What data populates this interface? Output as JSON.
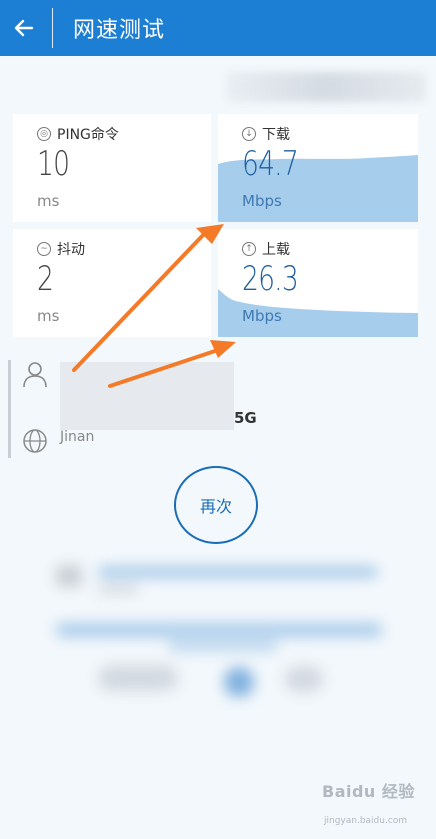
{
  "header": {
    "title": "网速测试",
    "back_icon": "arrow-left-icon"
  },
  "metrics": {
    "ping": {
      "label": "PING命令",
      "value": "10",
      "unit": "ms",
      "icon": "ping-icon"
    },
    "download": {
      "label": "下载",
      "value": "64.7",
      "unit": "Mbps",
      "icon": "download-arrow-icon"
    },
    "jitter": {
      "label": "抖动",
      "value": "2",
      "unit": "ms",
      "icon": "jitter-wave-icon"
    },
    "upload": {
      "label": "上载",
      "value": "26.3",
      "unit": "Mbps",
      "icon": "upload-arrow-icon"
    }
  },
  "connection": {
    "network_suffix": "5G",
    "location": "Jinan",
    "icons": [
      "person-icon",
      "globe-icon"
    ]
  },
  "actions": {
    "again_label": "再次"
  },
  "watermark": {
    "text": "Baidu 经验",
    "sub": "jingyan.baidu.com"
  },
  "colors": {
    "appbar": "#1c7fd4",
    "graph_fill": "#a6cdec",
    "accent_arrow": "#f47a28",
    "button_ring": "#1b6db6"
  }
}
